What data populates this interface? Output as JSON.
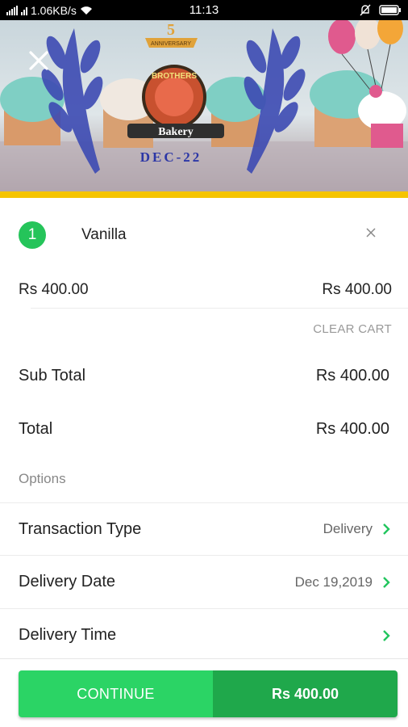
{
  "status_bar": {
    "speed": "1.06KB/s",
    "time": "11:13"
  },
  "banner": {
    "anniversary_text": "ANNIVERSARY",
    "brand_name": "BROTHERS",
    "brand_sub": "Bakery",
    "date_text": "DEC-22"
  },
  "cart": {
    "item": {
      "quantity": "1",
      "name": "Vanilla",
      "unit_price": "Rs 400.00",
      "line_total": "Rs 400.00"
    },
    "clear_cart_label": "CLEAR CART",
    "subtotal_label": "Sub Total",
    "subtotal_value": "Rs 400.00",
    "total_label": "Total",
    "total_value": "Rs 400.00"
  },
  "options": {
    "heading": "Options",
    "rows": [
      {
        "label": "Transaction Type",
        "value": "Delivery"
      },
      {
        "label": "Delivery Date",
        "value": "Dec 19,2019"
      },
      {
        "label": "Delivery Time",
        "value": ""
      }
    ]
  },
  "footer": {
    "continue_label": "CONTINUE",
    "amount": "Rs 400.00"
  },
  "colors": {
    "accent_green": "#2bd465",
    "dark_green": "#1fa84b",
    "stripe_yellow": "#f5c400"
  }
}
